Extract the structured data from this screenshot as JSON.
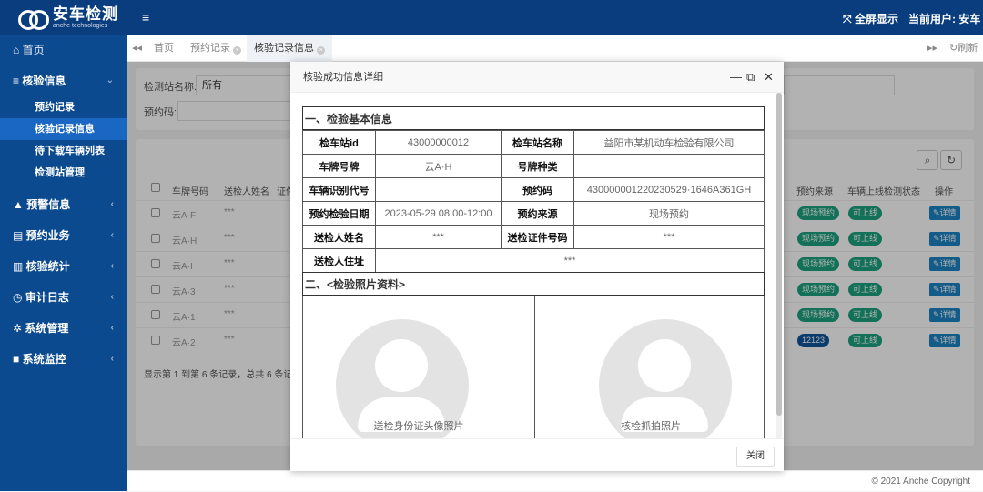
{
  "brand": {
    "title": "安车检测",
    "subtitle": "anche technologies"
  },
  "topbar": {
    "menu_icon": "≡",
    "fullscreen": "全屏显示",
    "current_user": "当前用户: 安车"
  },
  "sidebar": {
    "home": "首页",
    "inspection": "核验信息",
    "inspection_subs": [
      "预约记录",
      "核验记录信息",
      "待下载车辆列表",
      "检测站管理"
    ],
    "groups": [
      "预警信息",
      "预约业务",
      "核验统计",
      "审计日志",
      "系统管理",
      "系统监控"
    ]
  },
  "tabs": {
    "home": "首页",
    "tab1": "预约记录",
    "tab2": "核验记录信息",
    "refresh": "刷新"
  },
  "filters": {
    "station_label": "检测站名称:",
    "station_value": "所有",
    "code_label": "预约码:"
  },
  "table": {
    "headers": [
      "车牌号码",
      "送检人姓名",
      "证件",
      "预约来源",
      "车辆上线检测状态",
      "操作"
    ],
    "rows": [
      {
        "plate": "云A·F",
        "name": "***",
        "source": "现场预约",
        "status": "可上线",
        "action": "详情"
      },
      {
        "plate": "云A·H",
        "name": "***",
        "source": "现场预约",
        "status": "可上线",
        "action": "详情"
      },
      {
        "plate": "云A·I",
        "name": "***",
        "source": "现场预约",
        "status": "可上线",
        "action": "详情"
      },
      {
        "plate": "云A·3",
        "name": "***",
        "source": "现场预约",
        "status": "可上线",
        "action": "详情"
      },
      {
        "plate": "云A·1",
        "name": "***",
        "source": "现场预约",
        "status": "可上线",
        "action": "详情"
      },
      {
        "plate": "云A·2",
        "name": "***",
        "source": "12123",
        "status": "可上线",
        "action": "详情"
      }
    ],
    "summary": "显示第 1 到第 6 条记录，总共 6 条记录"
  },
  "modal": {
    "title": "核验成功信息详细",
    "section1": "一、检验基本信息",
    "section2": "二、<检验照片资料>",
    "fields": {
      "station_id_k": "检车站id",
      "station_id_v": "43000000012",
      "station_name_k": "检车站名称",
      "station_name_v": "益阳市某机动车检验有限公司",
      "plate_k": "车牌号牌",
      "plate_v": "云A·H",
      "plate_type_k": "号牌种类",
      "plate_type_v": "",
      "vin_k": "车辆识别代号",
      "vin_v": "",
      "code_k": "预约码",
      "code_v": "430000001220230529·1646A361GH",
      "date_k": "预约检验日期",
      "date_v": "2023-05-29 08:00-12:00",
      "source_k": "预约来源",
      "source_v": "现场预约",
      "sender_k": "送检人姓名",
      "sender_v": "***",
      "cert_k": "送检证件号码",
      "cert_v": "***",
      "addr_k": "送检人住址",
      "addr_v": "***"
    },
    "photo1": "送检身份证头像照片",
    "photo2": "核检抓拍照片",
    "close": "关闭"
  },
  "footer": "© 2021 Anche Copyright"
}
